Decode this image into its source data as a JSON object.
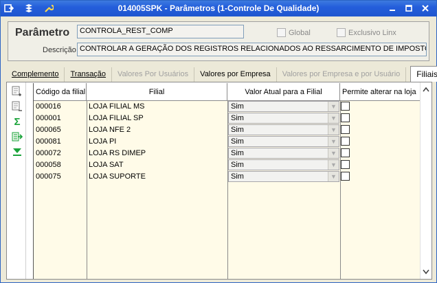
{
  "window": {
    "title": "014005SPK - Parâmetros (1-Controle De Qualidade)",
    "icons": [
      "window-menu-icon",
      "stack-icon",
      "wrench-icon"
    ],
    "controls": {
      "minimize": "‒",
      "maximize": "□",
      "close": "×"
    }
  },
  "header": {
    "parametro_label": "Parâmetro",
    "parametro_value": "CONTROLA_REST_COMP",
    "descricao_label": "Descrição",
    "descricao_value": "CONTROLAR A GERAÇÃO DOS REGISTROS RELACIONADOS AO RESSARCIMENTO DE IMPOSTOS NA EFD",
    "global_label": "Global",
    "exclusivo_label": "Exclusivo Linx"
  },
  "tabs": [
    {
      "label": "Complemento",
      "state": "normal"
    },
    {
      "label": "Transação",
      "state": "normal"
    },
    {
      "label": "Valores Por Usuários",
      "state": "disabled"
    },
    {
      "label": "Valores por Empresa",
      "state": "normal"
    },
    {
      "label": "Valores por Empresa e por Usuário",
      "state": "disabled"
    },
    {
      "label": "Filiais",
      "state": "active"
    }
  ],
  "toolbar": [
    "add-row-icon",
    "remove-row-icon",
    "sum-icon",
    "export-icon",
    "filter-down-icon"
  ],
  "grid": {
    "headers": {
      "codigo": "Código da filial",
      "filial": "Filial",
      "valor": "Valor Atual para a Filial",
      "permite": "Permite alterar na loja"
    },
    "rows": [
      {
        "codigo": "000016",
        "filial": "LOJA FILIAL MS",
        "valor": "Sim"
      },
      {
        "codigo": "000001",
        "filial": "LOJA FILIAL SP",
        "valor": "Sim"
      },
      {
        "codigo": "000065",
        "filial": "LOJA NFE 2",
        "valor": "Sim"
      },
      {
        "codigo": "000081",
        "filial": "LOJA PI",
        "valor": "Sim"
      },
      {
        "codigo": "000072",
        "filial": "LOJA RS DIMEP",
        "valor": "Sim"
      },
      {
        "codigo": "000058",
        "filial": "LOJA SAT",
        "valor": "Sim"
      },
      {
        "codigo": "000075",
        "filial": "LOJA SUPORTE",
        "valor": "Sim"
      }
    ]
  },
  "colors": {
    "titlebar": "#245edb",
    "window_bg": "#ece9d8",
    "grid_bg": "#fffbe8",
    "icon_green": "#1aa33a"
  }
}
